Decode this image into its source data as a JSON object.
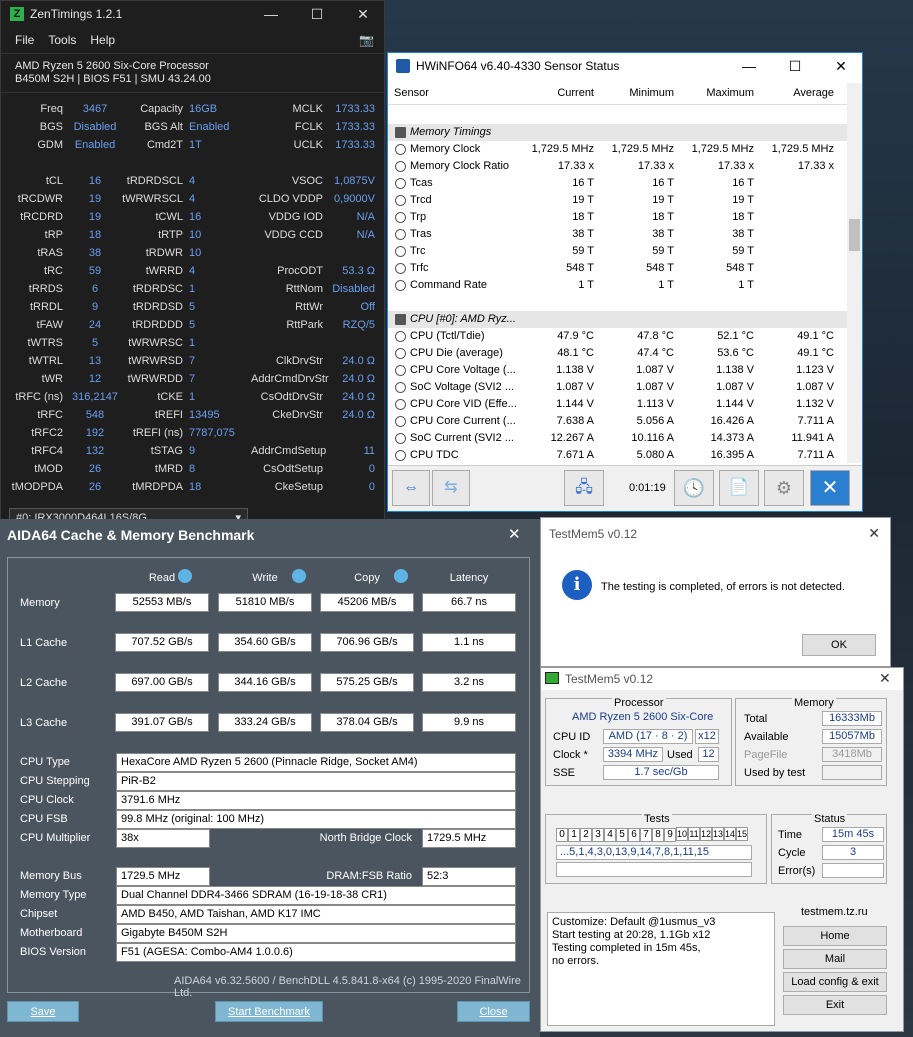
{
  "zentimings": {
    "title": "ZenTimings 1.2.1",
    "logo": "Z",
    "menu": [
      "File",
      "Tools",
      "Help"
    ],
    "cpu": "AMD Ryzen 5 2600 Six-Core Processor",
    "board": "B450M S2H | BIOS F51 | SMU 43.24.00",
    "col1": [
      [
        "Freq",
        "3467"
      ],
      [
        "BGS",
        "Disabled"
      ],
      [
        "GDM",
        "Enabled"
      ],
      [
        "",
        ""
      ],
      [
        "tCL",
        "16"
      ],
      [
        "tRCDWR",
        "19"
      ],
      [
        "tRCDRD",
        "19"
      ],
      [
        "tRP",
        "18"
      ],
      [
        "tRAS",
        "38"
      ],
      [
        "tRC",
        "59"
      ],
      [
        "tRRDS",
        "6"
      ],
      [
        "tRRDL",
        "9"
      ],
      [
        "tFAW",
        "24"
      ],
      [
        "tWTRS",
        "5"
      ],
      [
        "tWTRL",
        "13"
      ],
      [
        "tWR",
        "12"
      ],
      [
        "tRFC (ns)",
        "316,2147"
      ],
      [
        "tRFC",
        "548"
      ],
      [
        "tRFC2",
        "192"
      ],
      [
        "tRFC4",
        "132"
      ],
      [
        "tMOD",
        "26"
      ],
      [
        "tMODPDA",
        "26"
      ]
    ],
    "col2": [
      [
        "Capacity",
        "16GB"
      ],
      [
        "BGS Alt",
        "Enabled"
      ],
      [
        "Cmd2T",
        "1T"
      ],
      [
        "",
        ""
      ],
      [
        "tRDRDSCL",
        "4"
      ],
      [
        "tWRWRSCL",
        "4"
      ],
      [
        "tCWL",
        "16"
      ],
      [
        "tRTP",
        "10"
      ],
      [
        "tRDWR",
        "10"
      ],
      [
        "tWRRD",
        "4"
      ],
      [
        "tRDRDSC",
        "1"
      ],
      [
        "tRDRDSD",
        "5"
      ],
      [
        "tRDRDDD",
        "5"
      ],
      [
        "tWRWRSC",
        "1"
      ],
      [
        "tWRWRSD",
        "7"
      ],
      [
        "tWRWRDD",
        "7"
      ],
      [
        "tCKE",
        "1"
      ],
      [
        "tREFI",
        "13495"
      ],
      [
        "tREFI (ns)",
        "7787,075"
      ],
      [
        "tSTAG",
        "9"
      ],
      [
        "tMRD",
        "8"
      ],
      [
        "tMRDPDA",
        "18"
      ]
    ],
    "col3": [
      [
        "MCLK",
        "1733.33"
      ],
      [
        "FCLK",
        "1733.33"
      ],
      [
        "UCLK",
        "1733.33"
      ],
      [
        "",
        ""
      ],
      [
        "VSOC",
        "1,0875V"
      ],
      [
        "CLDO VDDP",
        "0,9000V"
      ],
      [
        "VDDG IOD",
        "N/A"
      ],
      [
        "VDDG CCD",
        "N/A"
      ],
      [
        "",
        ""
      ],
      [
        "ProcODT",
        "53.3 Ω"
      ],
      [
        "RttNom",
        "Disabled"
      ],
      [
        "RttWr",
        "Off"
      ],
      [
        "RttPark",
        "RZQ/5"
      ],
      [
        "",
        ""
      ],
      [
        "ClkDrvStr",
        "24.0 Ω"
      ],
      [
        "AddrCmdDrvStr",
        "24.0 Ω"
      ],
      [
        "CsOdtDrvStr",
        "24.0 Ω"
      ],
      [
        "CkeDrvStr",
        "24.0 Ω"
      ],
      [
        "",
        ""
      ],
      [
        "AddrCmdSetup",
        "11"
      ],
      [
        "CsOdtSetup",
        "0"
      ],
      [
        "CkeSetup",
        "0"
      ]
    ],
    "dimm_select": "#0: IRX3000D464L16S/8G"
  },
  "hwinfo": {
    "title": "HWiNFO64 v6.40-4330 Sensor Status",
    "headers": [
      "Sensor",
      "Current",
      "Minimum",
      "Maximum",
      "Average"
    ],
    "rows": [
      {
        "t": "sec",
        "n": "Memory Timings"
      },
      {
        "n": "Memory Clock",
        "v": [
          "1,729.5 MHz",
          "1,729.5 MHz",
          "1,729.5 MHz",
          "1,729.5 MHz"
        ]
      },
      {
        "n": "Memory Clock Ratio",
        "v": [
          "17.33 x",
          "17.33 x",
          "17.33 x",
          "17.33 x"
        ]
      },
      {
        "n": "Tcas",
        "v": [
          "16 T",
          "16 T",
          "16 T",
          ""
        ]
      },
      {
        "n": "Trcd",
        "v": [
          "19 T",
          "19 T",
          "19 T",
          ""
        ]
      },
      {
        "n": "Trp",
        "v": [
          "18 T",
          "18 T",
          "18 T",
          ""
        ]
      },
      {
        "n": "Tras",
        "v": [
          "38 T",
          "38 T",
          "38 T",
          ""
        ]
      },
      {
        "n": "Trc",
        "v": [
          "59 T",
          "59 T",
          "59 T",
          ""
        ]
      },
      {
        "n": "Trfc",
        "v": [
          "548 T",
          "548 T",
          "548 T",
          ""
        ]
      },
      {
        "n": "Command Rate",
        "v": [
          "1 T",
          "1 T",
          "1 T",
          ""
        ]
      },
      {
        "t": "gap",
        "n": ""
      },
      {
        "t": "sec",
        "n": "CPU [#0]: AMD Ryz..."
      },
      {
        "n": "CPU (Tctl/Tdie)",
        "v": [
          "47.9 °C",
          "47.8 °C",
          "52.1 °C",
          "49.1 °C"
        ]
      },
      {
        "n": "CPU Die (average)",
        "v": [
          "48.1 °C",
          "47.4 °C",
          "53.6 °C",
          "49.1 °C"
        ]
      },
      {
        "n": "CPU Core Voltage (...",
        "v": [
          "1.138 V",
          "1.087 V",
          "1.138 V",
          "1.123 V"
        ]
      },
      {
        "n": "SoC Voltage (SVI2 ...",
        "v": [
          "1.087 V",
          "1.087 V",
          "1.087 V",
          "1.087 V"
        ]
      },
      {
        "n": "CPU Core VID (Effe...",
        "v": [
          "1.144 V",
          "1.113 V",
          "1.144 V",
          "1.132 V"
        ]
      },
      {
        "n": "CPU Core Current (...",
        "v": [
          "7.638 A",
          "5.056 A",
          "16.426 A",
          "7.711 A"
        ]
      },
      {
        "n": "SoC Current (SVI2 ...",
        "v": [
          "12.267 A",
          "10.116 A",
          "14.373 A",
          "11.941 A"
        ]
      },
      {
        "n": "CPU TDC",
        "v": [
          "7.671 A",
          "5.080 A",
          "16.395 A",
          "7.711 A"
        ]
      }
    ],
    "timer": "0:01:19"
  },
  "aida": {
    "title": "AIDA64 Cache & Memory Benchmark",
    "headers": [
      "Read",
      "Write",
      "Copy",
      "Latency"
    ],
    "bench": [
      {
        "label": "Memory",
        "v": [
          "52553 MB/s",
          "51810 MB/s",
          "45206 MB/s",
          "66.7 ns"
        ]
      },
      {
        "label": "L1 Cache",
        "v": [
          "707.52 GB/s",
          "354.60 GB/s",
          "706.96 GB/s",
          "1.1 ns"
        ]
      },
      {
        "label": "L2 Cache",
        "v": [
          "697.00 GB/s",
          "344.16 GB/s",
          "575.25 GB/s",
          "3.2 ns"
        ]
      },
      {
        "label": "L3 Cache",
        "v": [
          "391.07 GB/s",
          "333.24 GB/s",
          "378.04 GB/s",
          "9.9 ns"
        ]
      }
    ],
    "info": [
      [
        "CPU Type",
        "HexaCore AMD Ryzen 5 2600  (Pinnacle Ridge, Socket AM4)"
      ],
      [
        "CPU Stepping",
        "PiR-B2"
      ],
      [
        "CPU Clock",
        "3791.6 MHz"
      ],
      [
        "CPU FSB",
        "99.8 MHz  (original: 100 MHz)"
      ],
      [
        "CPU Multiplier",
        "38x"
      ]
    ],
    "nb_label": "North Bridge Clock",
    "nb_value": "1729.5 MHz",
    "info2": [
      [
        "Memory Bus",
        "1729.5 MHz"
      ],
      [
        "Memory Type",
        "Dual Channel DDR4-3466 SDRAM  (16-19-18-38 CR1)"
      ],
      [
        "Chipset",
        "AMD B450, AMD Taishan, AMD K17 IMC"
      ],
      [
        "Motherboard",
        "Gigabyte B450M S2H"
      ],
      [
        "BIOS Version",
        "F51  (AGESA: Combo-AM4 1.0.0.6)"
      ]
    ],
    "dram_label": "DRAM:FSB Ratio",
    "dram_value": "52:3",
    "footer": "AIDA64 v6.32.5600 / BenchDLL 4.5.841.8-x64  (c) 1995-2020 FinalWire Ltd.",
    "buttons": [
      "Save",
      "Start Benchmark",
      "Close"
    ]
  },
  "tm_dialog": {
    "title": "TestMem5 v0.12",
    "message": "The testing is completed, of errors is not detected.",
    "ok": "OK"
  },
  "testmem": {
    "title": "TestMem5 v0.12",
    "proc_title": "Processor",
    "cpu": "AMD Ryzen 5 2600 Six-Core",
    "cpuid_label": "CPU ID",
    "cpuid": "AMD  (17 · 8 · 2)",
    "cpuid_x": "x12",
    "clock_label": "Clock *",
    "clock": "3394 MHz",
    "used_label": "Used",
    "used": "12",
    "sse_label": "SSE",
    "sse": "1.7 sec/Gb",
    "mem_title": "Memory",
    "total_label": "Total",
    "total": "16333Mb",
    "avail_label": "Available",
    "avail": "15057Mb",
    "pf_label": "PageFile",
    "pf": "3418Mb",
    "ubt_label": "Used by test",
    "tests_title": "Tests",
    "cells": [
      "0",
      "1",
      "2",
      "3",
      "4",
      "5",
      "6",
      "7",
      "8",
      "9",
      "10",
      "11",
      "12",
      "13",
      "14",
      "15"
    ],
    "sequence": "...5,1,4,3,0,13,9,14,7,8,1,11,15",
    "status_title": "Status",
    "time_label": "Time",
    "time": "15m 45s",
    "cycle_label": "Cycle",
    "cycle": "3",
    "err_label": "Error(s)",
    "log": [
      "Customize: Default @1usmus_v3",
      "Start testing at 20:28, 1.1Gb x12",
      "Testing completed in 15m 45s,",
      "no errors."
    ],
    "site": "testmem.tz.ru",
    "buttons": [
      "Home",
      "Mail",
      "Load config & exit",
      "Exit"
    ]
  }
}
